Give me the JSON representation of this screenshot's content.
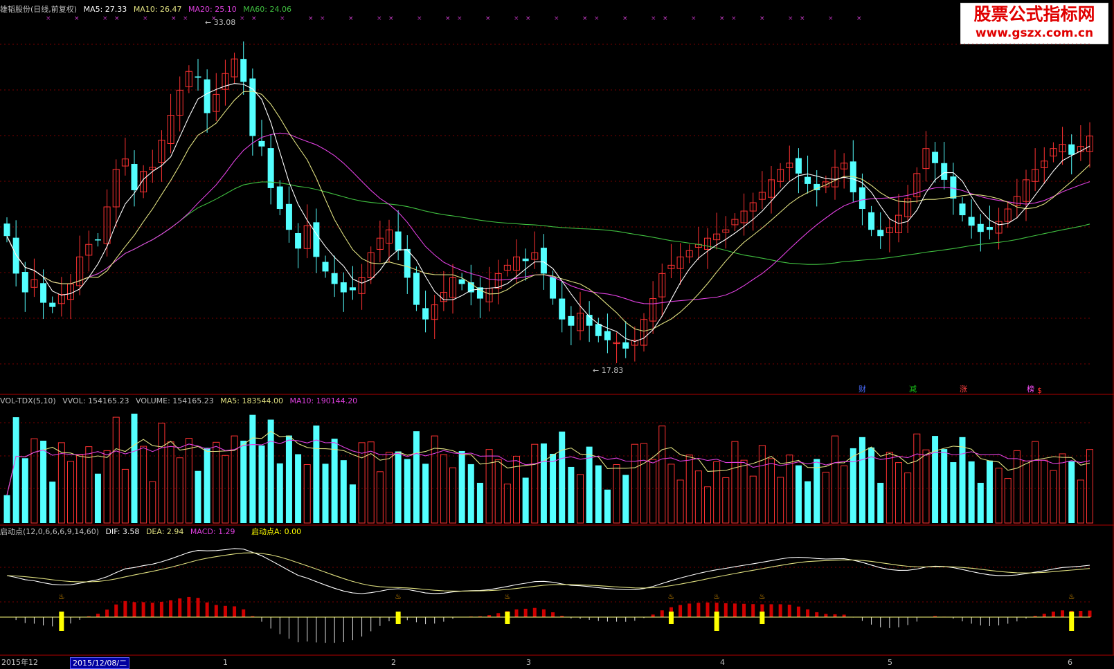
{
  "main_info": {
    "stock": "雄韬股份(日线,前复权)",
    "ma5_label": "MA5: 27.33",
    "ma10_label": "MA10: 26.47",
    "ma20_label": "MA20: 25.10",
    "ma60_label": "MA60: 24.06"
  },
  "price_markers": {
    "high": "33.08",
    "low": "17.83"
  },
  "event_markers": [
    {
      "label": "财",
      "color": "#4a6cff"
    },
    {
      "label": "减",
      "color": "#18c018"
    },
    {
      "label": "涨",
      "color": "#ff4040"
    },
    {
      "label": "榜",
      "color": "#ff50ff"
    },
    {
      "label": "$",
      "color": "#ff3030"
    }
  ],
  "vol_info": {
    "name": "VOL-TDX(5,10)",
    "vvol": "VVOL: 154165.23",
    "volume": "VOLUME: 154165.23",
    "ma5": "MA5: 183544.00",
    "ma10": "MA10: 190144.20"
  },
  "macd_info": {
    "name": "启动点(12,0,6,6,6,9,14,60)",
    "dif": "DIF: 3.58",
    "dea": "DEA: 2.94",
    "macd": "MACD: 1.29",
    "signal": "启动点A: 0.00"
  },
  "axis": {
    "year_label": "2015年12",
    "selected_date": "2015/12/08/二",
    "months": [
      "1",
      "2",
      "3",
      "4",
      "5",
      "6"
    ]
  },
  "watermark": {
    "line1": "股票公式指标网",
    "line2": "www.gszx.com.cn"
  },
  "colors": {
    "up": "#ff3232",
    "down": "#54ffff",
    "ma5": "#ffffff",
    "ma10": "#e0e080",
    "ma20": "#e040e0",
    "ma60": "#40c040",
    "signal": "#ffff00"
  },
  "chart_data": {
    "type": "candlestick",
    "high": 33.08,
    "low": 17.83,
    "close_series": [
      23.6,
      21.8,
      20.9,
      21.5,
      20.4,
      20.2,
      20.8,
      21.3,
      22.6,
      23.2,
      23.4,
      25.0,
      26.8,
      27.3,
      25.8,
      26.7,
      26.9,
      28.2,
      29.4,
      30.6,
      31.5,
      31.2,
      29.5,
      30.4,
      31.4,
      32.1,
      31.0,
      28.4,
      27.9,
      25.9,
      24.9,
      23.9,
      23.0,
      24.1,
      22.6,
      21.9,
      21.3,
      20.9,
      21.0,
      21.6,
      22.8,
      23.5,
      23.9,
      22.9,
      21.6,
      20.3,
      19.6,
      20.3,
      20.9,
      21.6,
      21.3,
      20.9,
      20.6,
      21.1,
      21.8,
      22.2,
      22.6,
      22.4,
      22.8,
      21.8,
      20.6,
      19.6,
      19.3,
      19.9,
      19.3,
      18.8,
      18.6,
      18.5,
      18.2,
      18.6,
      19.6,
      20.6,
      21.8,
      22.2,
      22.6,
      22.9,
      23.2,
      23.5,
      23.7,
      23.9,
      24.4,
      24.8,
      25.2,
      25.7,
      26.3,
      26.8,
      27.1,
      26.6,
      26.1,
      25.8,
      26.2,
      26.9,
      27.1,
      25.7,
      24.9,
      23.9,
      23.6,
      24.0,
      24.6,
      25.4,
      26.6,
      27.8,
      27.1,
      26.3,
      25.4,
      24.6,
      24.1,
      23.8,
      23.9,
      24.3,
      24.9,
      25.5,
      26.3,
      26.8,
      27.2,
      27.8,
      28.0,
      27.5,
      27.9,
      28.4
    ]
  }
}
